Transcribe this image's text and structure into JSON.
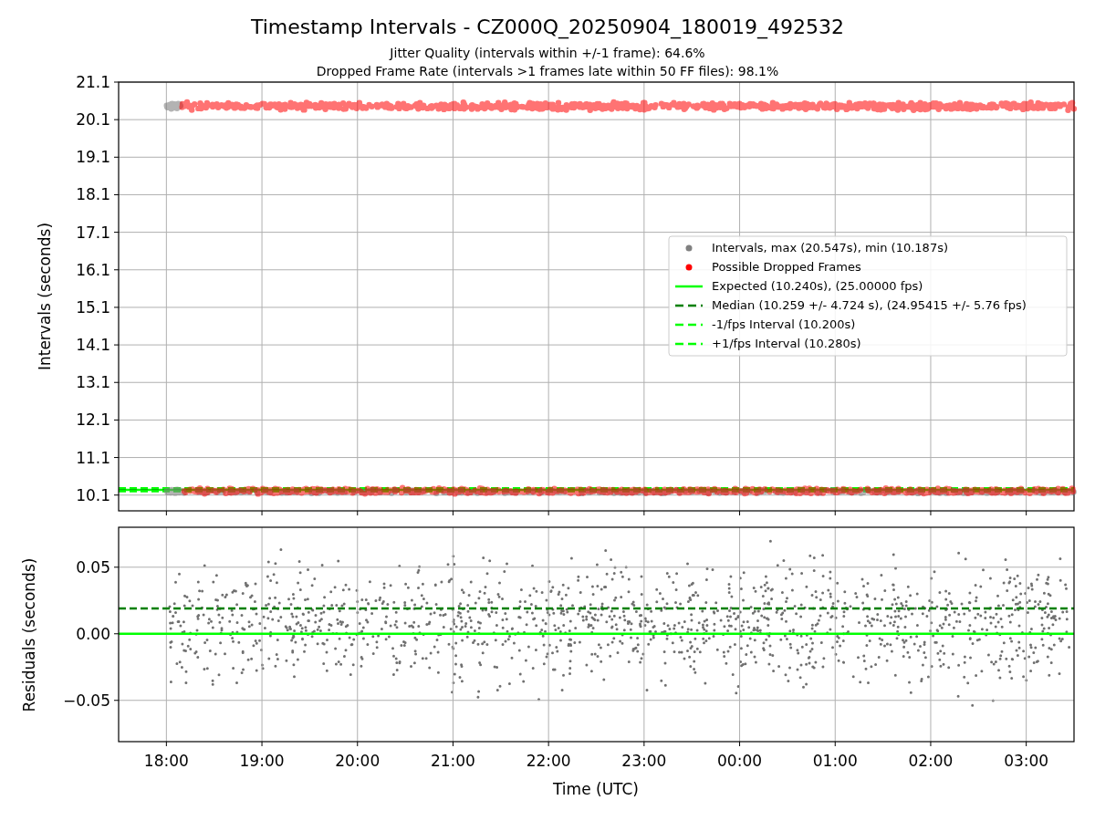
{
  "title": "Timestamp Intervals - CZ000Q_20250904_180019_492532",
  "subtitles": [
    "Jitter Quality (intervals within +/-1 frame): 64.6%",
    "Dropped Frame Rate (intervals >1 frames late within 50 FF files): 98.1%"
  ],
  "intervals_chart": {
    "chart_data": {
      "type": "scatter",
      "ylabel": "Intervals (seconds)",
      "ylim": [
        9.68,
        21.1
      ],
      "grid": true,
      "categories": [
        null,
        null,
        null,
        null,
        null,
        null,
        null,
        null,
        null,
        null
      ],
      "yticks": [
        {
          "value": 10.1,
          "label": "10.1"
        },
        {
          "value": 11.1,
          "label": "11.1"
        },
        {
          "value": 12.1,
          "label": "12.1"
        },
        {
          "value": 13.1,
          "label": "13.1"
        },
        {
          "value": 14.1,
          "label": "14.1"
        },
        {
          "value": 15.1,
          "label": "15.1"
        },
        {
          "value": 16.1,
          "label": "16.1"
        },
        {
          "value": 17.1,
          "label": "17.1"
        },
        {
          "value": 18.1,
          "label": "18.1"
        },
        {
          "value": 19.1,
          "label": "19.1"
        },
        {
          "value": 20.1,
          "label": "20.1"
        },
        {
          "value": 21.1,
          "label": "21.1"
        }
      ],
      "ref_lines": [
        {
          "axis": "y",
          "value": 10.24,
          "color": "#00ff00"
        },
        {
          "axis": "y",
          "value": 10.26,
          "color": "#008000"
        },
        {
          "axis": "y",
          "value": 10.2,
          "color": "#00ff00"
        },
        {
          "axis": "y",
          "value": 10.28,
          "color": "#00ff00"
        }
      ]
    },
    "legend": [
      {
        "kind": "dot",
        "label": "Intervals, max (20.547s), min (10.187s)",
        "color": "#808080"
      },
      {
        "kind": "dot",
        "label": "Possible Dropped Frames",
        "color": "#ff0000"
      },
      {
        "kind": "solid",
        "label": "Expected (10.240s), (25.00000 fps)",
        "color": "#00ff00"
      },
      {
        "kind": "dashed",
        "label": "Median (10.259 +/- 4.724 s), (24.95415 +/- 5.76 fps)",
        "color": "#008000"
      },
      {
        "kind": "dashed",
        "label": "-1/fps Interval (10.200s)",
        "color": "#00ff00"
      },
      {
        "kind": "dashed",
        "label": "+1/fps Interval (10.280s)",
        "color": "#00ff00"
      }
    ]
  },
  "residuals_chart": {
    "chart_data": {
      "type": "scatter",
      "xlabel": "Time (UTC)",
      "ylabel": "Residuals (seconds)",
      "ylim": [
        -0.081,
        0.08
      ],
      "grid": true,
      "categories": [
        "18:00",
        "19:00",
        "20:00",
        "21:00",
        "22:00",
        "23:00",
        "00:00",
        "01:00",
        "02:00",
        "03:00"
      ],
      "yticks": [
        {
          "value": 0.05,
          "label": "0.05"
        },
        {
          "value": 0,
          "label": "0.00"
        },
        {
          "value": -0.05,
          "label": "−0.05"
        }
      ],
      "ref_lines": [
        {
          "axis": "y",
          "value": 0.019,
          "color": "#008000"
        },
        {
          "axis": "y",
          "value": 0,
          "color": "#00ff00"
        }
      ]
    }
  }
}
